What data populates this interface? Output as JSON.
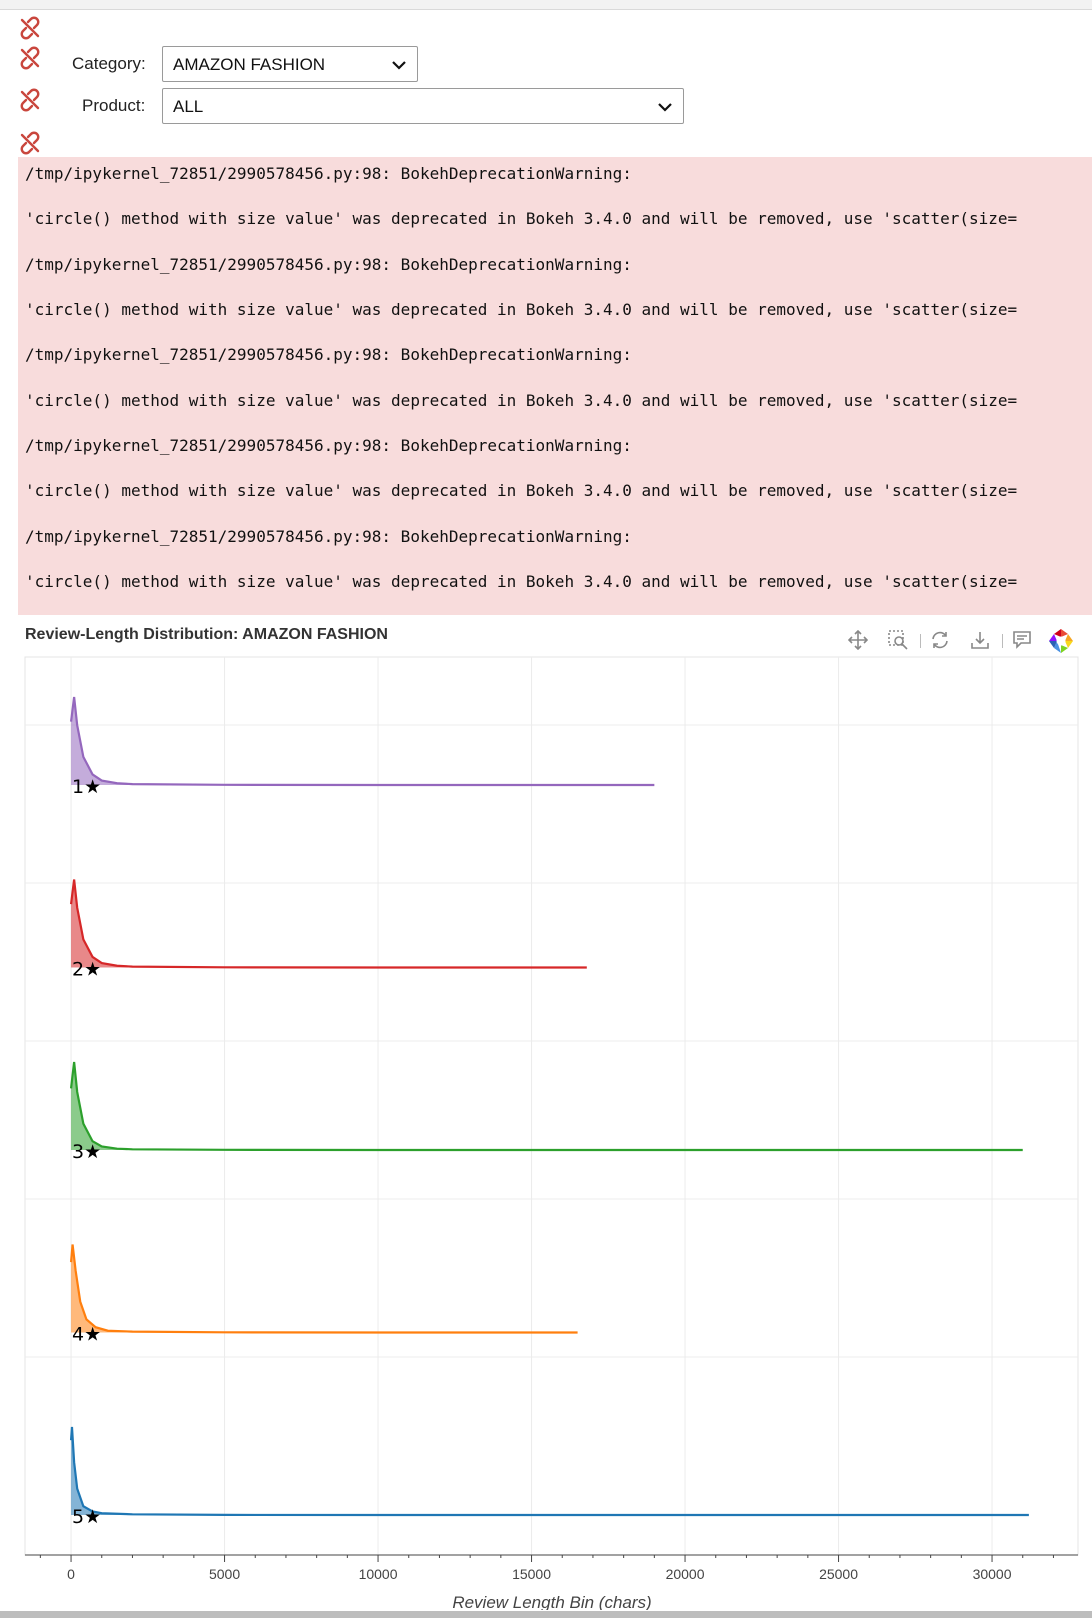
{
  "controls": {
    "category_label": "Category:",
    "category_value": "AMAZON FASHION",
    "product_label": "Product:",
    "product_value": "ALL"
  },
  "warnings": [
    "/tmp/ipykernel_72851/2990578456.py:98: BokehDeprecationWarning:",
    "'circle() method with size value' was deprecated in Bokeh 3.4.0 and will be removed, use 'scatter(size=",
    "/tmp/ipykernel_72851/2990578456.py:98: BokehDeprecationWarning:",
    "'circle() method with size value' was deprecated in Bokeh 3.4.0 and will be removed, use 'scatter(size=",
    "/tmp/ipykernel_72851/2990578456.py:98: BokehDeprecationWarning:",
    "'circle() method with size value' was deprecated in Bokeh 3.4.0 and will be removed, use 'scatter(size=",
    "/tmp/ipykernel_72851/2990578456.py:98: BokehDeprecationWarning:",
    "'circle() method with size value' was deprecated in Bokeh 3.4.0 and will be removed, use 'scatter(size=",
    "/tmp/ipykernel_72851/2990578456.py:98: BokehDeprecationWarning:",
    "'circle() method with size value' was deprecated in Bokeh 3.4.0 and will be removed, use 'scatter(size="
  ],
  "toolbar": {
    "tools": [
      "pan-icon",
      "box-zoom-icon",
      "reset-icon",
      "save-icon",
      "hover-icon",
      "bokeh-logo"
    ]
  },
  "chart_data": {
    "type": "area",
    "title": "Review-Length Distribution: AMAZON FASHION",
    "xlabel": "Review Length Bin (chars)",
    "ylabel": "",
    "xlim": [
      -1500,
      32800
    ],
    "xticks": [
      0,
      5000,
      10000,
      15000,
      20000,
      25000,
      30000
    ],
    "xtick_labels": [
      "0",
      "5000",
      "10000",
      "15000",
      "20000",
      "25000",
      "30000"
    ],
    "grid": true,
    "categories": [
      "1★",
      "2★",
      "3★",
      "4★",
      "5★"
    ],
    "series": [
      {
        "name": "1★",
        "color": "#9467bd",
        "x": [
          0,
          100,
          200,
          400,
          700,
          1000,
          1500,
          2000,
          5000,
          10000,
          15000,
          19000
        ],
        "y": [
          0.72,
          1.0,
          0.68,
          0.32,
          0.12,
          0.05,
          0.02,
          0.01,
          0.002,
          0.0,
          0.0,
          0.0
        ]
      },
      {
        "name": "2★",
        "color": "#d62728",
        "x": [
          0,
          100,
          200,
          400,
          700,
          1000,
          1500,
          2000,
          5000,
          10000,
          15000,
          16800
        ],
        "y": [
          0.72,
          1.0,
          0.68,
          0.32,
          0.12,
          0.05,
          0.02,
          0.01,
          0.002,
          0.0,
          0.0,
          0.0
        ]
      },
      {
        "name": "3★",
        "color": "#2ca02c",
        "x": [
          0,
          100,
          200,
          400,
          700,
          1000,
          1500,
          2000,
          5000,
          10000,
          20000,
          31000
        ],
        "y": [
          0.7,
          1.0,
          0.66,
          0.3,
          0.1,
          0.04,
          0.015,
          0.008,
          0.002,
          0.0,
          0.0,
          0.0
        ]
      },
      {
        "name": "4★",
        "color": "#ff7f0e",
        "x": [
          0,
          50,
          150,
          300,
          500,
          800,
          1200,
          2000,
          5000,
          10000,
          15000,
          16500
        ],
        "y": [
          0.8,
          1.0,
          0.7,
          0.35,
          0.15,
          0.06,
          0.02,
          0.01,
          0.002,
          0.0,
          0.0,
          0.0
        ]
      },
      {
        "name": "5★",
        "color": "#1f77b4",
        "x": [
          0,
          30,
          100,
          200,
          400,
          700,
          1000,
          2000,
          5000,
          10000,
          20000,
          31200
        ],
        "y": [
          0.85,
          1.0,
          0.6,
          0.3,
          0.1,
          0.04,
          0.02,
          0.008,
          0.001,
          0.0,
          0.0,
          0.0
        ]
      }
    ]
  }
}
